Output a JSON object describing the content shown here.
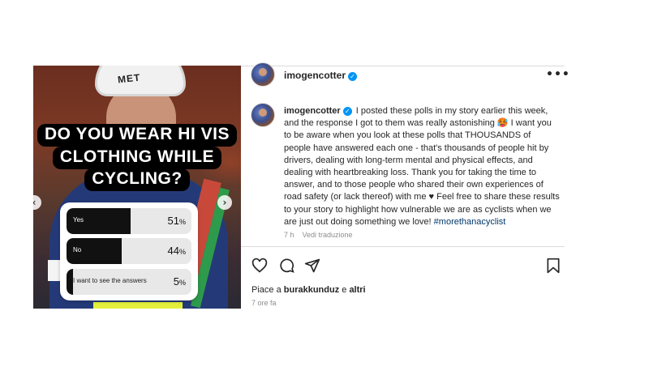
{
  "media": {
    "helmet_brand": "MET",
    "question_lines": [
      "DO YOU WEAR HI VIS",
      "CLOTHING WHILE",
      "CYCLING?"
    ],
    "poll": [
      {
        "label": "Yes",
        "percent_value": "51",
        "fraction": 0.51
      },
      {
        "label": "No",
        "percent_value": "44",
        "fraction": 0.44
      },
      {
        "label": "I want to see the answers",
        "percent_value": "5",
        "fraction": 0.05
      }
    ],
    "percent_symbol": "%",
    "prev_arrow": "‹",
    "next_arrow": "›"
  },
  "post": {
    "username": "imogencotter",
    "verified_mark": "✓",
    "more_icon": "•••",
    "caption_text": "I posted these polls in my story earlier this week, and the response I got to them was really astonishing 🥵 I want you to be aware when you look at these polls that THOUSANDS of people have answered each one - that's thousands of people hit by drivers, dealing with long-term mental and physical effects, and dealing with heartbreaking loss. Thank you for taking the time to answer, and to those people who shared their own experiences of road safety (or lack thereof) with me ♥ Feel free to share these results to your story to highlight how vulnerable we are as cyclists when we are just out doing something we love! ",
    "hashtag": "#morethanacyclist",
    "caption_age": "7 h",
    "see_translation": "Vedi traduzione",
    "likes_prefix": "Piace a ",
    "likes_user": "burakkunduz",
    "likes_suffix": " e ",
    "likes_others": "altri",
    "timestamp": "7 ore fa"
  },
  "colors": {
    "verified": "#0095f6",
    "hashtag": "#00376b",
    "muted": "#8e8e8e",
    "poll_fill": "#111111"
  },
  "icons": [
    "heart-icon",
    "comment-icon",
    "share-icon",
    "bookmark-icon",
    "more-icon",
    "verified-badge-icon"
  ]
}
